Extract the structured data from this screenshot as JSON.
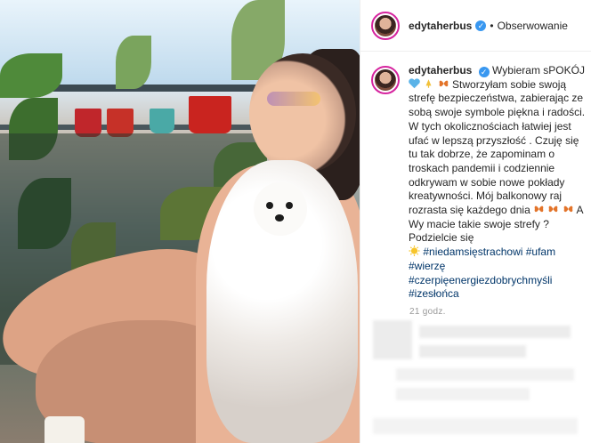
{
  "post": {
    "username": "edytaherbus",
    "verified_badge": "✓",
    "dot": "•",
    "follow_label": "Obserwowanie",
    "caption_user": "edytaherbus",
    "caption_lines": [
      "Wybieram sPOKÓJ",
      "Stworzyłam sobie swoją strefę bezpieczeństwa, zabierając ze sobą swoje symbole piękna i radości. W tych okolicznościach łatwiej jest ufać w lepszą przyszłość . Czuję się tu tak dobrze, że zapominam o troskach pandemii i codziennie odkrywam w sobie nowe pokłady kreatywności. Mój balkonowy raj rozrasta się każdego dnia",
      "A Wy macie takie swoje strefy ? Podzielcie się"
    ],
    "hashtags": [
      "#niedamsięstrachowi",
      "#ufam",
      "#wierzę",
      "#czerpięenergiezdobrychmyśli",
      "#izesłońca"
    ],
    "time": "21 godz."
  },
  "icons": {
    "verified": "verified-badge-icon",
    "heart": "blue-heart-emoji",
    "pray": "praying-hands-emoji",
    "butterfly": "butterfly-emoji",
    "sun": "sun-emoji"
  },
  "colors": {
    "verified": "#3897f0",
    "hashtag": "#003569",
    "avatar_ring": "#d6249f"
  }
}
